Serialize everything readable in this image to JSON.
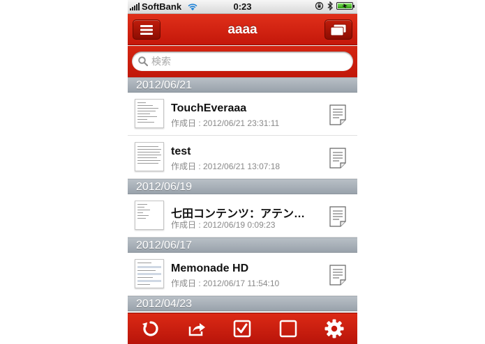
{
  "status_bar": {
    "carrier": "SoftBank",
    "time": "0:23",
    "icons": [
      "signal-icon",
      "wifi-icon",
      "rotation-lock-icon",
      "bluetooth-icon",
      "battery-icon"
    ]
  },
  "nav": {
    "title": "aaaa",
    "left_icon": "menu-icon",
    "right_icon": "notebooks-icon"
  },
  "search": {
    "placeholder": "検索",
    "value": ""
  },
  "sections": [
    {
      "date": "2012/06/21",
      "notes": [
        {
          "title": "TouchEveraaa",
          "created": "作成日 : 2012/06/21 23:31:11"
        },
        {
          "title": "test",
          "created": "作成日 : 2012/06/21 13:07:18"
        }
      ]
    },
    {
      "date": "2012/06/19",
      "notes": [
        {
          "title": "七田コンテンツ：アテン…",
          "created": "作成日 : 2012/06/19 0:09:23"
        }
      ]
    },
    {
      "date": "2012/06/17",
      "notes": [
        {
          "title": "Memonade HD",
          "created": "作成日 : 2012/06/17 11:54:10"
        }
      ]
    },
    {
      "date": "2012/04/23",
      "notes": []
    }
  ],
  "tab_bar": {
    "icons": [
      "refresh-icon",
      "share-icon",
      "select-all-icon",
      "deselect-icon",
      "settings-gear-icon"
    ]
  },
  "colors": {
    "brand_red": "#d42512",
    "section_gray": "#a5adb5"
  }
}
